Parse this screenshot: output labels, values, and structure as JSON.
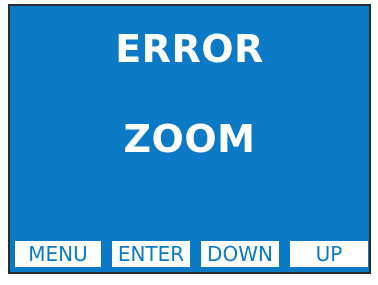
{
  "display": {
    "title": "ERROR",
    "message": "ZOOM"
  },
  "softkeys": {
    "menu": "MENU",
    "enter": "ENTER",
    "down": "DOWN",
    "up": "UP"
  },
  "colors": {
    "screen_background": "#0a7ac6",
    "text": "#ffffff",
    "softkey_background": "#ffffff",
    "softkey_text": "#0a7ac6",
    "border": "#2b2b2b"
  }
}
